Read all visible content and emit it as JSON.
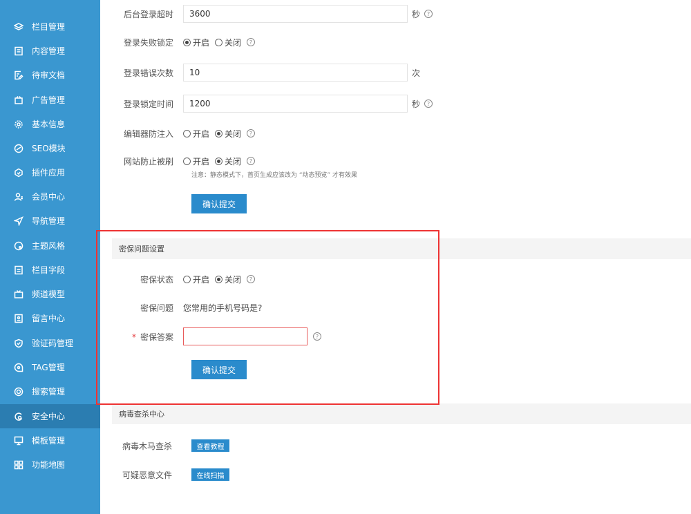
{
  "sidebar": {
    "items": [
      {
        "label": "栏目管理",
        "icon": "layers-icon"
      },
      {
        "label": "内容管理",
        "icon": "document-icon"
      },
      {
        "label": "待审文档",
        "icon": "edit-doc-icon"
      },
      {
        "label": "广告管理",
        "icon": "ad-icon"
      },
      {
        "label": "基本信息",
        "icon": "gear-icon"
      },
      {
        "label": "SEO模块",
        "icon": "seo-icon"
      },
      {
        "label": "插件应用",
        "icon": "plugin-icon"
      },
      {
        "label": "会员中心",
        "icon": "user-icon"
      },
      {
        "label": "导航管理",
        "icon": "navigate-icon"
      },
      {
        "label": "主题风格",
        "icon": "theme-icon"
      },
      {
        "label": "栏目字段",
        "icon": "field-icon"
      },
      {
        "label": "频道模型",
        "icon": "tv-icon"
      },
      {
        "label": "留言中心",
        "icon": "message-icon"
      },
      {
        "label": "验证码管理",
        "icon": "shield-check-icon"
      },
      {
        "label": "TAG管理",
        "icon": "tag-icon"
      },
      {
        "label": "搜索管理",
        "icon": "target-icon"
      },
      {
        "label": "安全中心",
        "icon": "security-icon",
        "active": true
      },
      {
        "label": "模板管理",
        "icon": "monitor-icon"
      },
      {
        "label": "功能地图",
        "icon": "grid-icon"
      }
    ]
  },
  "login": {
    "timeout_label": "后台登录超时",
    "timeout_value": "3600",
    "timeout_unit": "秒",
    "lock_label": "登录失败锁定",
    "on": "开启",
    "off": "关闭",
    "error_count_label": "登录错误次数",
    "error_count_value": "10",
    "error_count_unit": "次",
    "lock_time_label": "登录锁定时间",
    "lock_time_value": "1200",
    "lock_time_unit": "秒",
    "editor_label": "编辑器防注入",
    "refresh_label": "网站防止被刷",
    "refresh_note": "注意：静态模式下，首页生成应该改为 “动态预览” 才有效果",
    "submit": "确认提交"
  },
  "security_question": {
    "section_title": "密保问题设置",
    "status_label": "密保状态",
    "question_label": "密保问题",
    "question_value": "您常用的手机号码是?",
    "answer_label": "密保答案",
    "answer_value": "",
    "submit": "确认提交"
  },
  "virus": {
    "section_title": "病毒查杀中心",
    "trojan_label": "病毒木马查杀",
    "trojan_button": "查看教程",
    "suspicious_label": "可疑恶意文件",
    "suspicious_button": "在线扫描"
  },
  "help_glyph": "?",
  "colors": {
    "sidebar": "#3a97d0",
    "sidebar_active": "#2b7db1",
    "primary_button": "#2a8bcc",
    "highlight_box": "#ee3333"
  }
}
